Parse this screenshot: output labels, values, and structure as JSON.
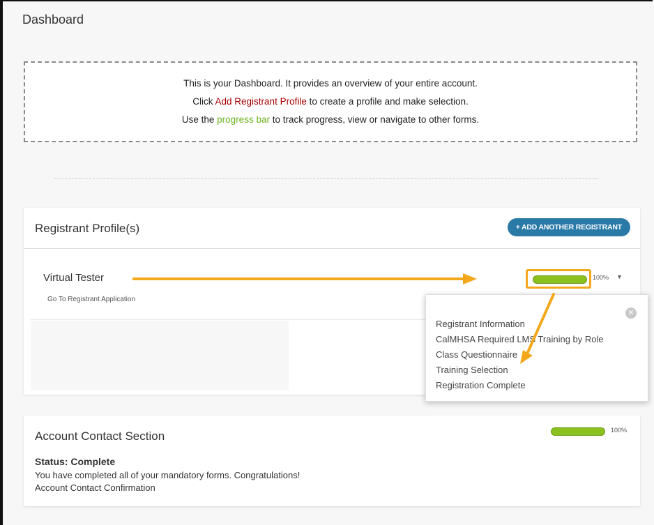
{
  "page": {
    "title": "Dashboard"
  },
  "banner": {
    "line1": "This is your Dashboard. It provides an overview of your entire account.",
    "line2_pre": "Click ",
    "line2_link": "Add Registrant Profile",
    "line2_post": " to create a profile and make selection.",
    "line3_pre": "Use the ",
    "line3_link": "progress bar",
    "line3_post": " to track progress, view or navigate to other forms."
  },
  "registrant_section": {
    "title": "Registrant Profile(s)",
    "add_button": "+ ADD ANOTHER REGISTRANT",
    "registrant_name": "Virtual Tester",
    "registrant_link": "Go To Registrant Application",
    "progress_percent": "100%",
    "progress_value": 1.0,
    "dropdown_icon": "caret-down-icon"
  },
  "progress_popup": {
    "items": [
      "Registrant Information",
      "CalMHSA Required LMS Training by Role",
      "Class Questionnaire",
      "Training Selection",
      "Registration Complete"
    ],
    "close_icon": "close-icon"
  },
  "account_section": {
    "title": "Account Contact Section",
    "progress_percent": "100%",
    "progress_value": 1.0,
    "status": "Status: Complete",
    "message": "You have completed all of your mandatory forms. Congratulations!",
    "confirmation": "Account Contact Confirmation"
  },
  "colors": {
    "accent_button": "#2a7aa8",
    "progress_green": "#8ac11e",
    "highlight_orange": "#f3a81c",
    "link_red": "#a60000",
    "link_green": "#6bb31d"
  }
}
